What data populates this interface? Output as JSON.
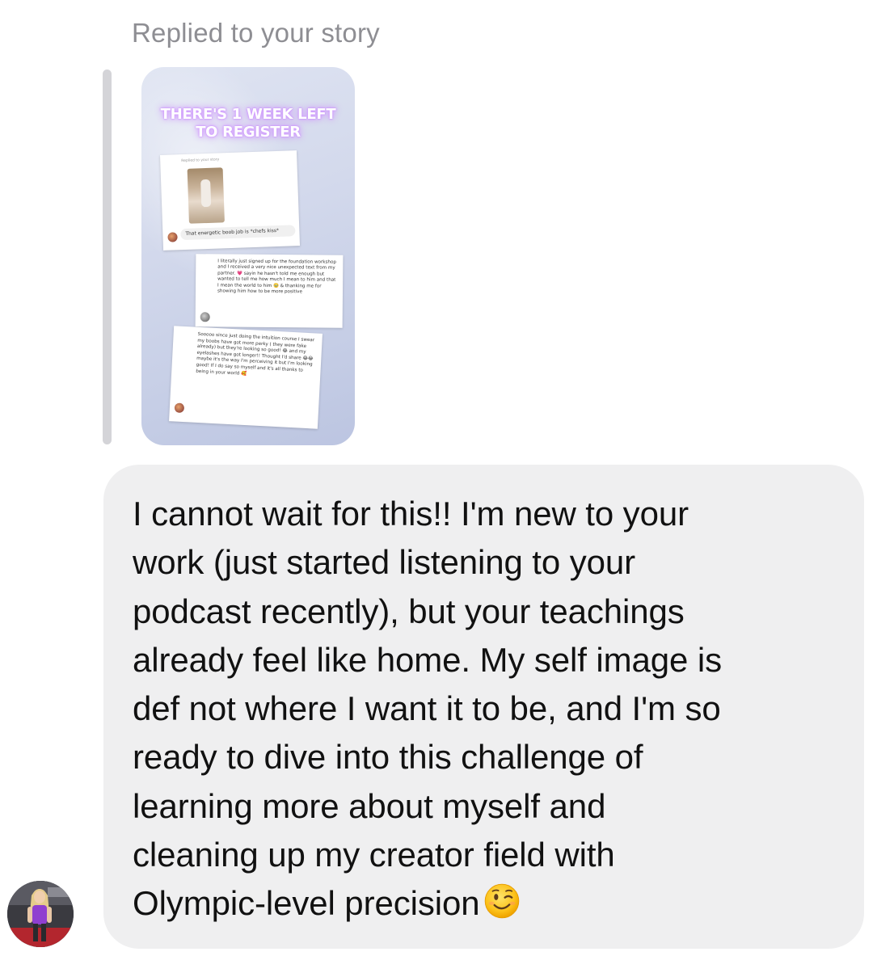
{
  "reply_header": {
    "label": "Replied to your story"
  },
  "story": {
    "headline": "THERE'S 1 WEEK LEFT TO REGISTER",
    "embedded_screenshots": [
      {
        "reply_label": "Replied to your story",
        "message": "That energetic boob job is *chefs kiss*"
      },
      {
        "message": "I literally just signed up for the foundation workshop and I received a very nice unexpected text from my partner. 💗 sayin he hasn't told me enough but wanted to tell me how much I mean to him and that I mean the world to him 🥹 & thanking me for showing him how to be more positive"
      },
      {
        "message": "Sooooo since just doing the intuition course I swear my boobs have got more perky ( they were fake already) but they're looking so good! 😂 and my eyelashes have got longer!! Thought I'd share 😂😂 maybe it's the way I'm perceiving it but I'm looking good! If I do say so myself and it's all thanks to being in your world 🥰"
      }
    ]
  },
  "message": {
    "text": "I cannot wait for this!! I'm new to your\nwork (just started listening to your\npodcast recently), but your teachings\nalready feel like home. My self image is\ndef not where I want it to be, and I'm so\nready to dive into this challenge of\nlearning more about myself and\ncleaning up my creator field with\nOlympic-level precision",
    "trailing_emoji": "winking-face-emoji"
  },
  "colors": {
    "bubble_bg": "#efeff0",
    "meta_text": "#8e8e93",
    "quote_bar": "#d4d4d8",
    "story_bg": "#cdd4ea"
  },
  "sender": {
    "avatar_icon": "profile-photo"
  }
}
